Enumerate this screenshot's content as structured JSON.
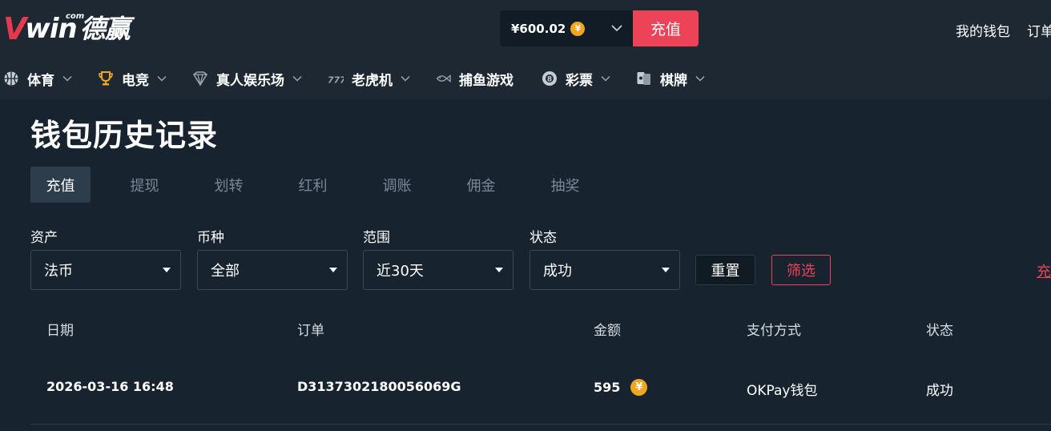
{
  "header": {
    "logo_mark": "V",
    "logo_word": "win",
    "logo_com": "com",
    "logo_cn": "德赢",
    "balance": "¥600.02",
    "currency_symbol": "¥",
    "deposit_label": "充值",
    "links": [
      "我的钱包",
      "订单"
    ]
  },
  "nav": {
    "items": [
      {
        "label": "体育",
        "icon": "basketball-icon"
      },
      {
        "label": "电竞",
        "icon": "trophy-icon"
      },
      {
        "label": "真人娱乐场",
        "icon": "diamond-icon"
      },
      {
        "label": "老虎机",
        "icon": "slot-777-icon"
      },
      {
        "label": "捕鱼游戏",
        "icon": "fish-icon"
      },
      {
        "label": "彩票",
        "icon": "lottery-ball-icon"
      },
      {
        "label": "棋牌",
        "icon": "cards-icon"
      }
    ]
  },
  "page": {
    "title": "钱包历史记录",
    "tabs": [
      "充值",
      "提现",
      "划转",
      "红利",
      "调账",
      "佣金",
      "抽奖"
    ],
    "active_tab": "充值"
  },
  "filters": {
    "asset": {
      "label": "资产",
      "value": "法币"
    },
    "currency": {
      "label": "币种",
      "value": "全部"
    },
    "range": {
      "label": "范围",
      "value": "近30天"
    },
    "status": {
      "label": "状态",
      "value": "成功"
    },
    "reset_label": "重置",
    "filter_label": "筛选",
    "right_link": "充值"
  },
  "table": {
    "headers": [
      "日期",
      "订单",
      "金额",
      "支付方式",
      "状态"
    ],
    "rows": [
      {
        "date": "2026-03-16 16:48",
        "order": "D3137302180056069G",
        "amount": "595",
        "currency_symbol": "¥",
        "method": "OKPay钱包",
        "status": "成功"
      }
    ]
  },
  "colors": {
    "background": "#17232f",
    "header": "#1d2833",
    "accent": "#ec4358",
    "coin": "#f2a61e",
    "muted_tab": "#7b8794"
  }
}
